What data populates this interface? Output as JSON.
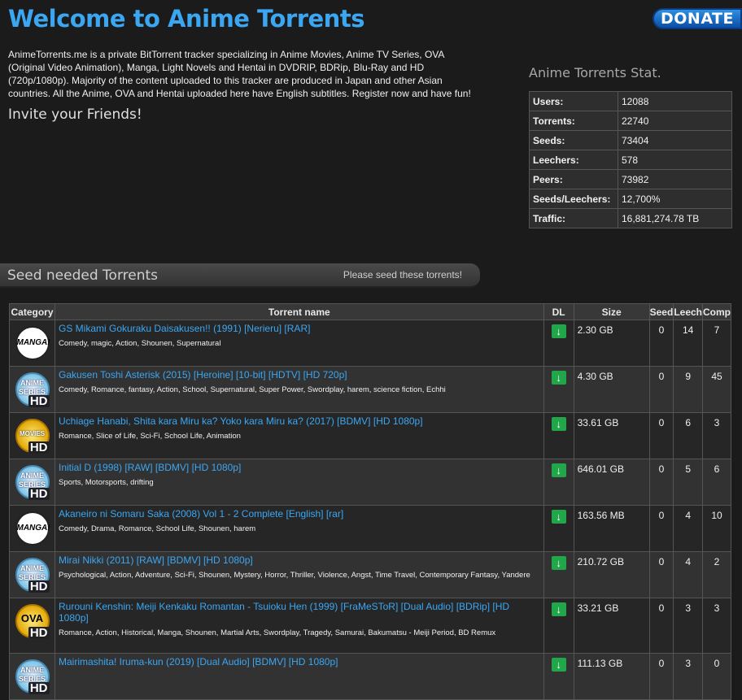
{
  "header": {
    "title": "Welcome to Anime Torrents",
    "donate_label": "DONATE"
  },
  "intro": {
    "text": "AnimeTorrents.me is a private BitTorrent tracker specializing in Anime Movies, Anime TV Series, OVA (Original Video Animation), Manga, Light Novels and Hentai in DVDRIP, BDRip, Blu-Ray and HD (720p/1080p). Majority of the content uploaded to this tracker are produced in Japan and other Asian countries. All the Anime, OVA and Hentai uploaded here have English subtitles. Register now and have fun!",
    "invite": "Invite your Friends!"
  },
  "stats": {
    "title": "Anime Torrents Stat.",
    "rows": [
      {
        "k": "Users:",
        "v": "12088"
      },
      {
        "k": "Torrents:",
        "v": "22740"
      },
      {
        "k": "Seeds:",
        "v": "73404"
      },
      {
        "k": "Leechers:",
        "v": "578"
      },
      {
        "k": "Peers:",
        "v": "73982"
      },
      {
        "k": "Seeds/Leechers:",
        "v": "12,700%"
      },
      {
        "k": "Traffic:",
        "v": "16,881,274.78 TB"
      }
    ]
  },
  "seed_bar": {
    "title": "Seed needed Torrents",
    "note": "Please seed these torrents!"
  },
  "table": {
    "headers": {
      "category": "Category",
      "name": "Torrent name",
      "dl": "DL",
      "size": "Size",
      "seed": "Seed",
      "leech": "Leech",
      "comp": "Comp"
    },
    "rows": [
      {
        "cat": "MANGA!",
        "title": "GS Mikami Gokuraku Daisakusen!! (1991) [Nerieru] [RAR]",
        "sub": "",
        "tags": "Comedy, magic, Action, Shounen, Supernatural",
        "size": "2.30 GB",
        "seed": "0",
        "leech": "14",
        "comp": "7"
      },
      {
        "cat": "ANIME SERIES",
        "title": "Gakusen Toshi Asterisk (2015) [Heroine] [10-bit]",
        "sub": " [HDTV] [HD 720p]",
        "tags": "Comedy, Romance, fantasy, Action, School, Supernatural, Super Power, Swordplay, harem, science fiction, Echhi",
        "size": "4.30 GB",
        "seed": "0",
        "leech": "9",
        "comp": "45"
      },
      {
        "cat": "MOVIES",
        "title": "Uchiage Hanabi, Shita kara Miru ka? Yoko kara Miru ka? (2017) [BDMV] [HD 1080p]",
        "sub": "",
        "tags": "Romance, Slice of Life, Sci-Fi, School Life, Animation",
        "size": "33.61 GB",
        "seed": "0",
        "leech": "6",
        "comp": "3"
      },
      {
        "cat": "ANIME SERIES",
        "title": "Initial D (1998) [RAW] [BDMV] [HD 1080p]",
        "sub": "",
        "tags": "Sports, Motorsports, drifting",
        "size": "646.01 GB",
        "seed": "0",
        "leech": "5",
        "comp": "6"
      },
      {
        "cat": "MANGA!",
        "title": "Akaneiro ni Somaru Saka (2008) Vol 1 - 2 Complete [English] [rar]",
        "sub": "",
        "tags": "Comedy, Drama, Romance, School Life, Shounen, harem",
        "size": "163.56 MB",
        "seed": "0",
        "leech": "4",
        "comp": "10"
      },
      {
        "cat": "ANIME SERIES",
        "title": "Mirai Nikki (2011) [RAW] [BDMV] [HD 1080p]",
        "sub": "",
        "tags": "Psychological, Action, Adventure, Sci-Fi, Shounen, Mystery, Horror, Thriller, Violence, Angst, Time Travel, Contemporary Fantasy, Yandere",
        "size": "210.72 GB",
        "seed": "0",
        "leech": "4",
        "comp": "2"
      },
      {
        "cat": "OVA",
        "title": "Rurouni Kenshin: Meiji Kenkaku Romantan - Tsuioku Hen (1999) [FraMeSToR] [Dual Audio]",
        "sub": " [BDRip] [HD 1080p]",
        "tags": "Romance, Action, Historical, Manga, Shounen, Martial Arts, Swordplay, Tragedy, Samurai, Bakumatsu - Meiji Period, BD Remux",
        "size": "33.21 GB",
        "seed": "0",
        "leech": "3",
        "comp": "3"
      },
      {
        "cat": "ANIME SERIES",
        "title": "Mairimashita! Iruma-kun (2019) [Dual Audio] [BDMV] [HD 1080p]",
        "sub": "",
        "tags": "",
        "size": "111.13 GB",
        "seed": "0",
        "leech": "3",
        "comp": "0"
      }
    ]
  }
}
